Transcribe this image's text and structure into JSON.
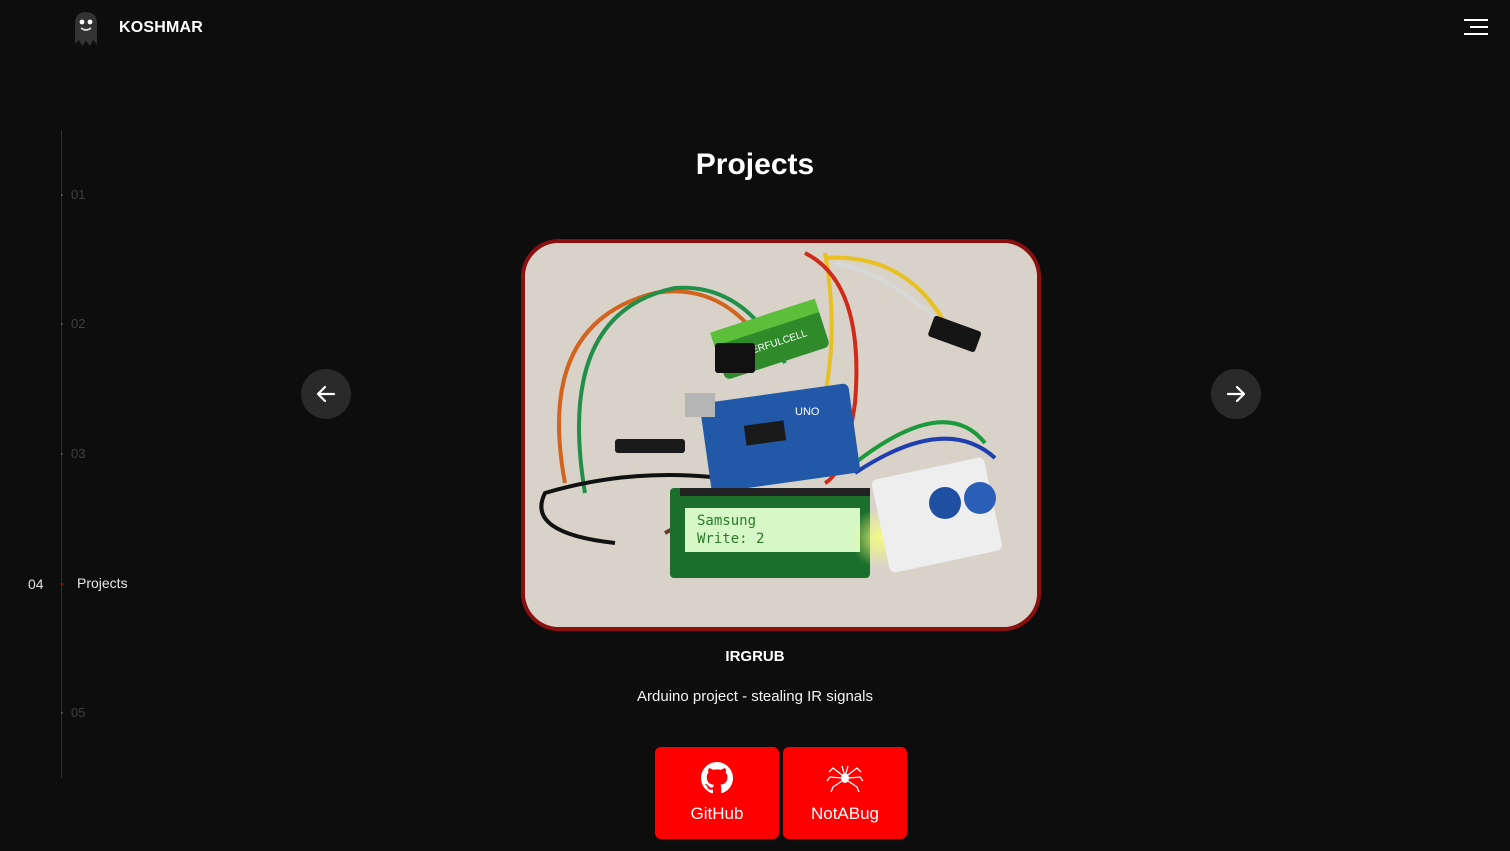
{
  "header": {
    "brand": "KOSHMAR",
    "logo_icon": "ghost-logo-icon",
    "menu_icon": "hamburger-menu-icon"
  },
  "side_nav": {
    "items": [
      {
        "number": "01",
        "label": ""
      },
      {
        "number": "02",
        "label": ""
      },
      {
        "number": "03",
        "label": ""
      },
      {
        "number": "04",
        "label": "Projects",
        "active": true
      },
      {
        "number": "05",
        "label": ""
      }
    ]
  },
  "main": {
    "section_title": "Projects",
    "carousel": {
      "prev_icon": "arrow-left-icon",
      "next_icon": "arrow-right-icon",
      "project": {
        "name": "IRGRUB",
        "description": "Arduino project - stealing IR signals",
        "image_text": {
          "battery": "POWERFULCELL",
          "board": "UNO",
          "lcd_line1": "Samsung",
          "lcd_line2": "Write: 2"
        }
      }
    },
    "buttons": [
      {
        "label": "GitHub",
        "icon": "github-icon"
      },
      {
        "label": "NotABug",
        "icon": "bug-icon"
      }
    ]
  },
  "colors": {
    "background": "#0d0d0d",
    "accent": "#ff0000",
    "frame_border": "#8a1010",
    "arrow_bg": "#2a2a2a"
  }
}
